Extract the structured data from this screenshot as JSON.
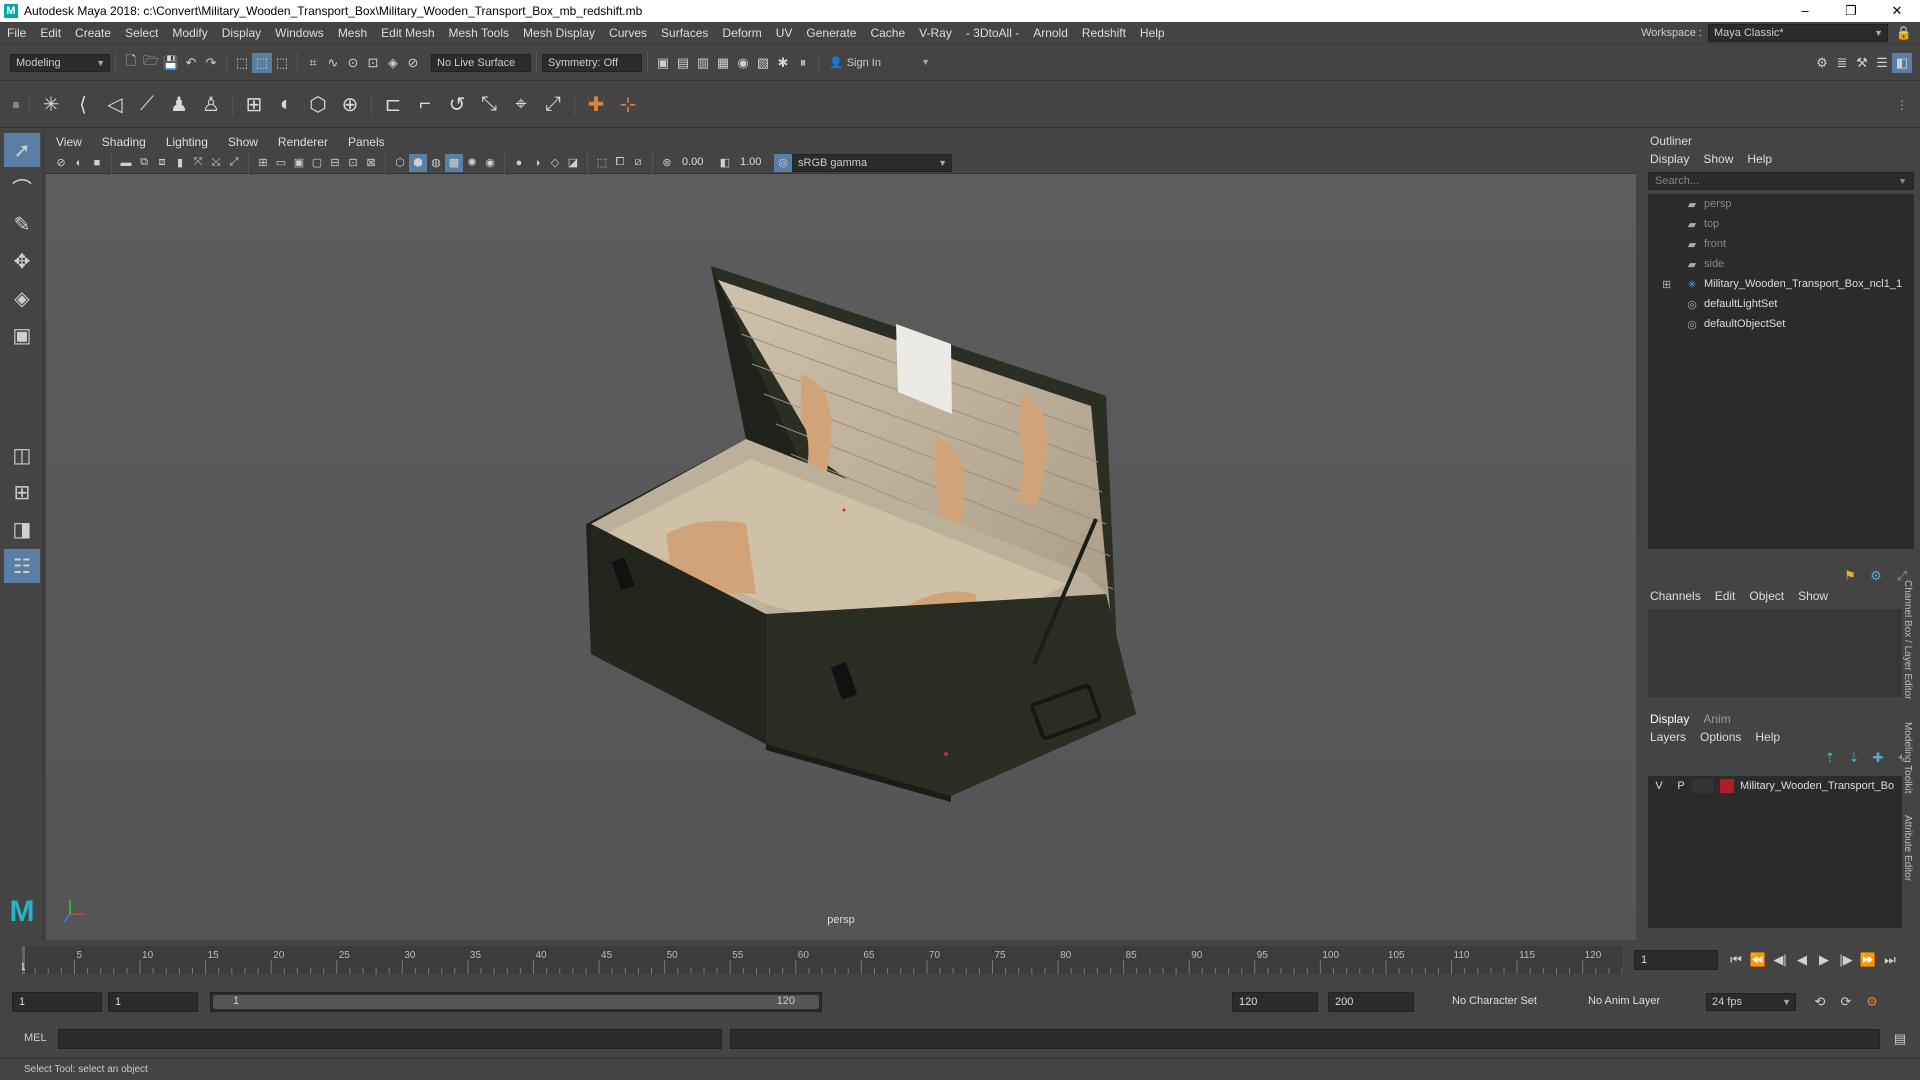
{
  "window": {
    "title": "Autodesk Maya 2018: c:\\Convert\\Military_Wooden_Transport_Box\\Military_Wooden_Transport_Box_mb_redshift.mb",
    "logo": "M",
    "minimize": "–",
    "maximize": "❐",
    "close": "✕"
  },
  "menubar": {
    "items": [
      "File",
      "Edit",
      "Create",
      "Select",
      "Modify",
      "Display",
      "Windows",
      "Mesh",
      "Edit Mesh",
      "Mesh Tools",
      "Mesh Display",
      "Curves",
      "Surfaces",
      "Deform",
      "UV",
      "Generate",
      "Cache",
      "V-Ray",
      "- 3DtoAll -",
      "Arnold",
      "Redshift",
      "Help"
    ],
    "workspace_label": "Workspace :",
    "workspace_value": "Maya Classic*"
  },
  "statusline": {
    "mode": "Modeling",
    "live_surface": "No Live Surface",
    "symmetry": "Symmetry: Off",
    "sign_in": "Sign In"
  },
  "viewport": {
    "menu": [
      "View",
      "Shading",
      "Lighting",
      "Show",
      "Renderer",
      "Panels"
    ],
    "exposure": "0.00",
    "gamma": "1.00",
    "color_space": "sRGB gamma",
    "camera": "persp"
  },
  "outliner": {
    "title": "Outliner",
    "menu": [
      "Display",
      "Show",
      "Help"
    ],
    "search_placeholder": "Search...",
    "items": [
      {
        "label": "persp",
        "icon": "camera-icon",
        "dim": true
      },
      {
        "label": "top",
        "icon": "camera-icon",
        "dim": true
      },
      {
        "label": "front",
        "icon": "camera-icon",
        "dim": true
      },
      {
        "label": "side",
        "icon": "camera-icon",
        "dim": true
      },
      {
        "label": "Military_Wooden_Transport_Box_ncl1_1",
        "icon": "transform-icon",
        "dim": false
      },
      {
        "label": "defaultLightSet",
        "icon": "set-icon",
        "dim": false
      },
      {
        "label": "defaultObjectSet",
        "icon": "set-icon",
        "dim": false
      }
    ]
  },
  "channelbox": {
    "menu": [
      "Channels",
      "Edit",
      "Object",
      "Show"
    ]
  },
  "layers": {
    "tabs": [
      "Display",
      "Anim"
    ],
    "menu": [
      "Layers",
      "Options",
      "Help"
    ],
    "row": {
      "v": "V",
      "p": "P",
      "name": "Military_Wooden_Transport_Bo",
      "color": "#b01a2a"
    }
  },
  "side_tabs": [
    "Channel Box / Layer Editor",
    "Modeling Toolkit",
    "Attribute Editor"
  ],
  "timeline": {
    "ticks": [
      "5",
      "10",
      "15",
      "20",
      "25",
      "30",
      "35",
      "40",
      "45",
      "50",
      "55",
      "60",
      "65",
      "70",
      "75",
      "80",
      "85",
      "90",
      "95",
      "100",
      "105",
      "110",
      "115",
      "120"
    ],
    "current_frame": "1",
    "frame_field": "1"
  },
  "range": {
    "start": "1",
    "anim_start": "1",
    "slider_start": "1",
    "slider_end": "120",
    "end": "120",
    "anim_end": "200",
    "character_set": "No Character Set",
    "anim_layer": "No Anim Layer",
    "fps": "24 fps"
  },
  "cmdline": {
    "label": "MEL"
  },
  "helpline": {
    "text": "Select Tool: select an object"
  }
}
